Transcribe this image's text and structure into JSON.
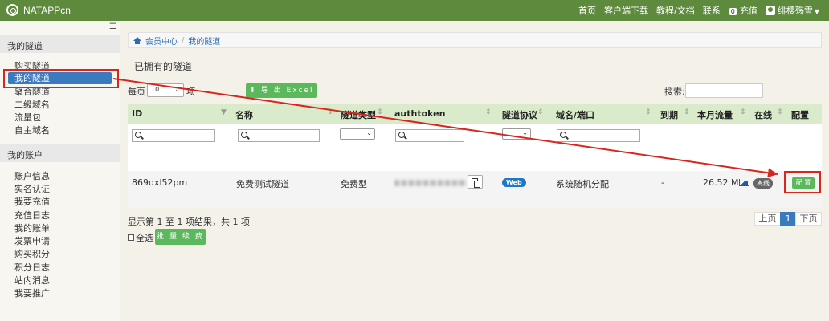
{
  "topbar": {
    "brand": "NATAPPcn",
    "nav": [
      "首页",
      "客户端下载",
      "教程/文档",
      "联系"
    ],
    "balance": "0",
    "recharge": "充值",
    "username": "绯樱殇雪"
  },
  "sidebar": {
    "tunnels_section": "我的隧道",
    "tunnel_items": [
      "购买隧道",
      "我的隧道",
      "聚合隧道",
      "二级域名",
      "流量包",
      "自主域名"
    ],
    "account_section": "我的账户",
    "account_items": [
      "账户信息",
      "实名认证",
      "我要充值",
      "充值日志",
      "我的账单",
      "发票申请",
      "购买积分",
      "积分日志",
      "站内消息",
      "我要推广"
    ]
  },
  "breadcrumb": [
    "会员中心",
    "我的隧道"
  ],
  "page_title": "已拥有的隧道",
  "controls": {
    "per_page_label": "每页",
    "per_page_value": "10",
    "per_page_suffix": "项",
    "export_label": "导 出 Excel",
    "search_label": "搜索:"
  },
  "table": {
    "headers": [
      "ID",
      "名称",
      "隧道类型",
      "authtoken",
      "隧道协议",
      "域名/端口",
      "到期",
      "本月流量",
      "在线",
      "配置"
    ],
    "rows": [
      {
        "id": "869dxl52pm",
        "name": "免费测试隧道",
        "type": "免费型",
        "protocol": "Web",
        "domain": "系统随机分配",
        "expire": "-",
        "traffic": "26.52 M",
        "online": "离线",
        "config": "配 置"
      }
    ]
  },
  "footer": {
    "info": "显示第 1 至 1 项结果，共 1 项",
    "select_all": "全选",
    "batch_renew": "批 量 续 费",
    "prev": "上页",
    "page": "1",
    "next": "下页"
  },
  "colors": {
    "topbar": "#5e8a3d",
    "active_blue": "#3a7abf",
    "green_button": "#5cb85c",
    "annotation_red": "#d9261c",
    "table_header": "#d9ebcb"
  }
}
